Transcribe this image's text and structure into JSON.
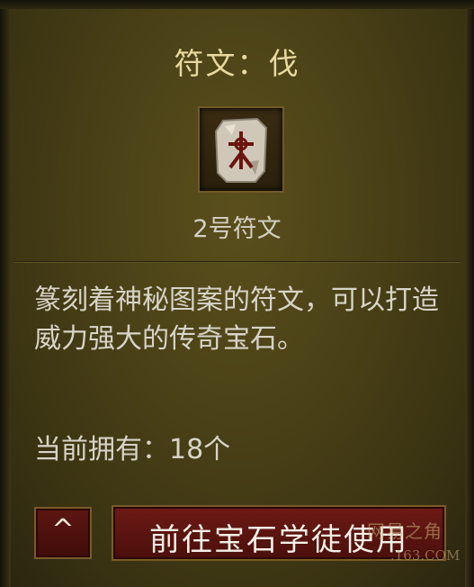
{
  "tooltip": {
    "title": "符文：伐",
    "subtitle": "2号符文",
    "description": "篆刻着神秘图案的符文，可以打造威力强大的传奇宝石。",
    "owned": "当前拥有：18个",
    "rune_icon": "rune-stone-icon",
    "collapse_button": {
      "label": "^",
      "icon": "chevron-up-icon"
    },
    "goto_button": {
      "label": "前往宝石学徒使用"
    }
  },
  "watermark": {
    "line1": "网易之角",
    "line2": ".163.COM"
  },
  "colors": {
    "panel_bg": "#4a4117",
    "title_text": "#e9d9a0",
    "body_text": "#d8d4c8",
    "button_red": "#6e1a15",
    "button_border": "#7a5a2a"
  }
}
